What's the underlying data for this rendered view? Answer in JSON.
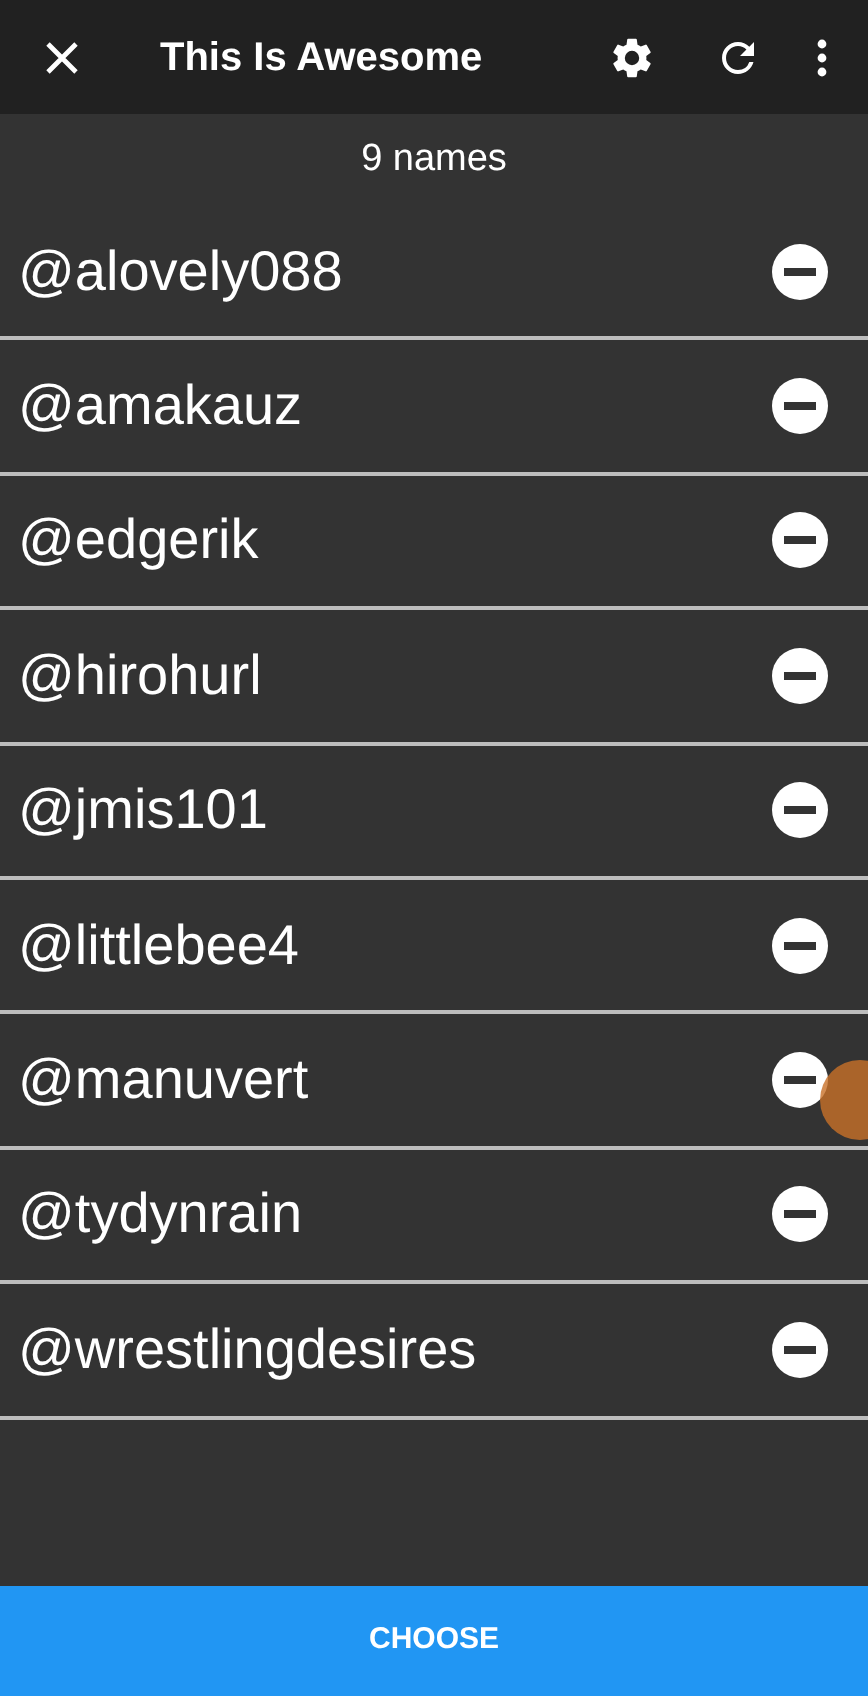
{
  "app_bar": {
    "title": "This Is Awesome"
  },
  "count": "9 names",
  "names": [
    "@alovely088",
    "@amakauz",
    "@edgerik",
    "@hirohurl",
    "@jmis101",
    "@littlebee4",
    "@manuvert",
    "@tydynrain",
    "@wrestlingdesires"
  ],
  "button": "CHOOSE"
}
